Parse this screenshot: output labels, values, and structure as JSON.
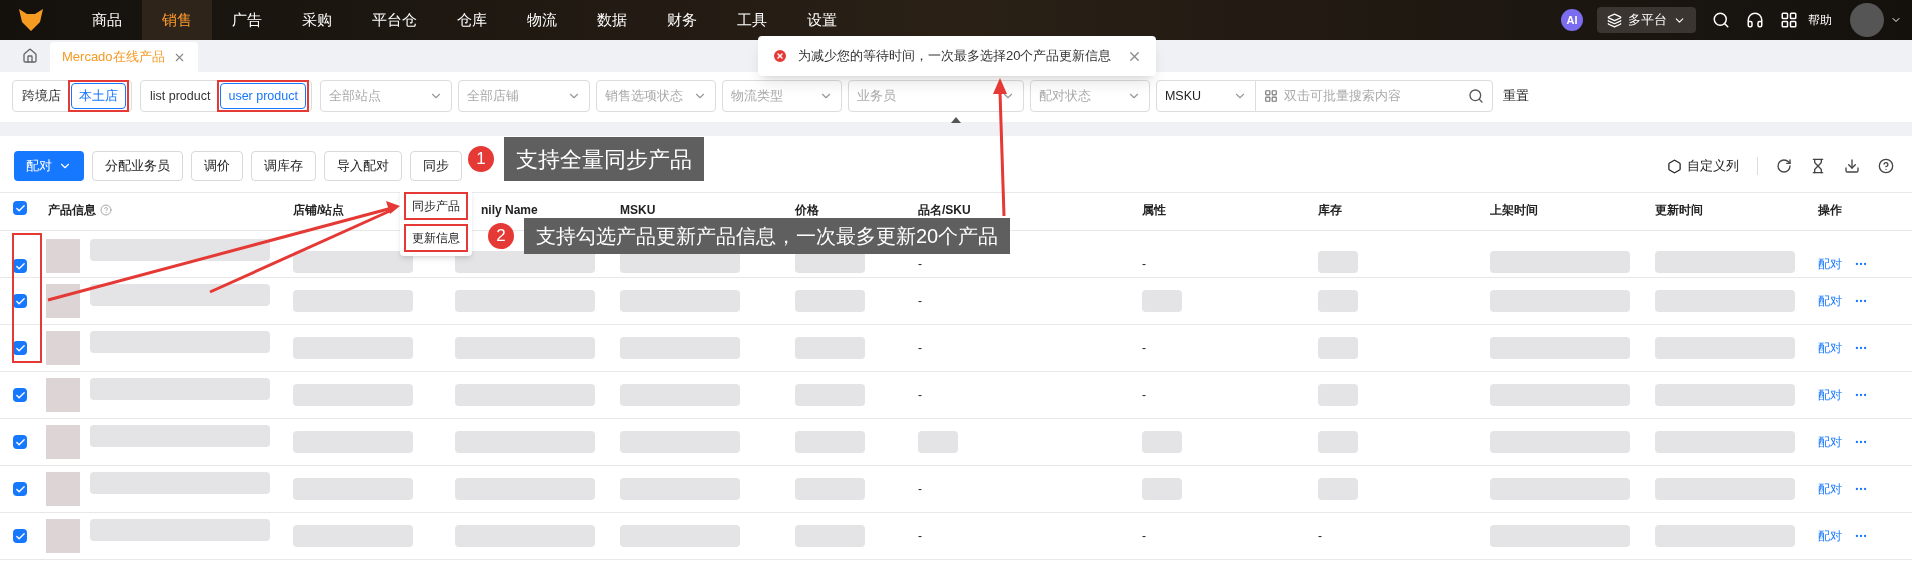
{
  "nav": {
    "items": [
      {
        "label": "商品",
        "selected": false
      },
      {
        "label": "销售",
        "selected": true
      },
      {
        "label": "广告",
        "selected": false
      },
      {
        "label": "采购",
        "selected": false
      },
      {
        "label": "平台仓",
        "selected": false
      },
      {
        "label": "仓库",
        "selected": false
      },
      {
        "label": "物流",
        "selected": false
      },
      {
        "label": "数据",
        "selected": false
      },
      {
        "label": "财务",
        "selected": false
      },
      {
        "label": "工具",
        "selected": false
      },
      {
        "label": "设置",
        "selected": false
      }
    ],
    "ai": "AI",
    "platform": "多平台",
    "help": "帮助"
  },
  "tabs": [
    {
      "label": "Mercado在线产品",
      "selected": true
    }
  ],
  "filters": {
    "store_types": [
      {
        "label": "跨境店",
        "selected": false,
        "highlighted": false
      },
      {
        "label": "本土店",
        "selected": true,
        "highlighted": true
      }
    ],
    "product_types": [
      {
        "label": "list product",
        "selected": false,
        "highlighted": false
      },
      {
        "label": "user product",
        "selected": true,
        "highlighted": true
      }
    ],
    "selects": [
      {
        "placeholder": "全部站点"
      },
      {
        "placeholder": "全部店铺"
      },
      {
        "placeholder": "销售选项状态"
      },
      {
        "placeholder": "物流类型"
      },
      {
        "placeholder": "业务员"
      },
      {
        "placeholder": "配对状态"
      }
    ],
    "search_type": "MSKU",
    "search": {
      "placeholder": "双击可批量搜索内容"
    },
    "reset": "重置"
  },
  "toolbar": {
    "buttons": [
      {
        "label": "配对",
        "kind": "primary"
      },
      {
        "label": "分配业务员",
        "kind": "default"
      },
      {
        "label": "调价",
        "kind": "default"
      },
      {
        "label": "调库存",
        "kind": "default"
      },
      {
        "label": "导入配对",
        "kind": "default"
      },
      {
        "label": "同步",
        "kind": "default"
      }
    ],
    "sync_menu": [
      {
        "label": "同步产品",
        "highlighted": true
      },
      {
        "label": "更新信息",
        "highlighted": true
      }
    ],
    "custom_columns": "自定义列"
  },
  "table": {
    "select_all": {
      "checked": true
    },
    "columns": [
      "产品信息",
      "店铺/站点",
      "nily Name",
      "MSKU",
      "价格",
      "品名/SKU",
      "属性",
      "库存",
      "上架时间",
      "更新时间",
      "操作"
    ],
    "rows": [
      {
        "checked": true,
        "sku": "-",
        "attribute": "-",
        "action": "配对"
      },
      {
        "checked": true,
        "sku": "-",
        "action": "配对"
      },
      {
        "checked": true,
        "sku": "-",
        "attribute": "-",
        "action": "配对"
      },
      {
        "checked": true,
        "sku": "-",
        "attribute": "-",
        "action": "配对"
      },
      {
        "checked": true,
        "action": "配对"
      },
      {
        "checked": true,
        "sku": "-",
        "action": "配对"
      },
      {
        "checked": true,
        "sku": "-",
        "attribute": "-",
        "stock": "-",
        "action": "配对"
      }
    ]
  },
  "annotations": [
    {
      "number": "1",
      "text": "支持全量同步产品"
    },
    {
      "number": "2",
      "text": "支持勾选产品更新产品信息，一次最多更新20个产品"
    }
  ],
  "toast": {
    "text": "为减少您的等待时间，一次最多选择20个产品更新信息"
  }
}
